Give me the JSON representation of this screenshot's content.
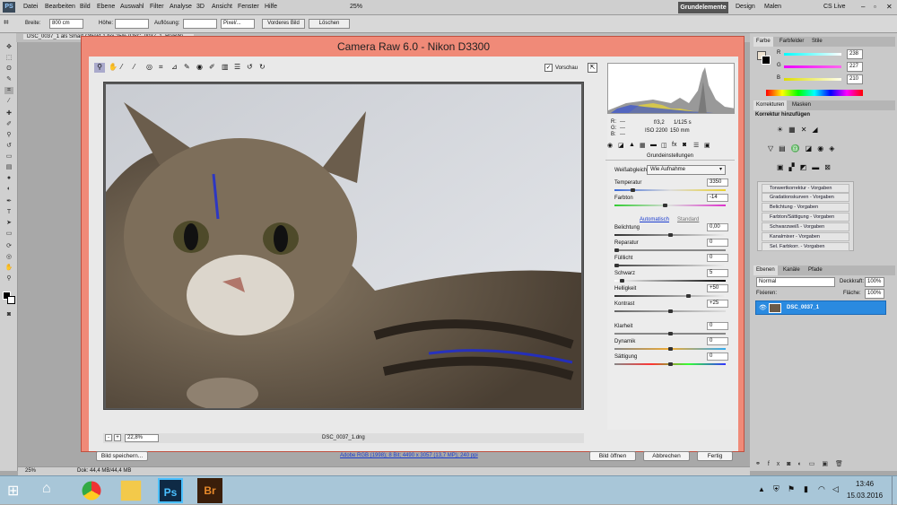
{
  "menubar": {
    "app_logo": "PS",
    "items": [
      "Datei",
      "Bearbeiten",
      "Bild",
      "Ebene",
      "Auswahl",
      "Filter",
      "Analyse",
      "3D",
      "Ansicht",
      "Fenster",
      "Hilfe"
    ],
    "zoom": "25%",
    "workspaces": {
      "active": "Grundelemente",
      "others": [
        "Design",
        "Malen"
      ]
    },
    "cs_live": "CS Live"
  },
  "optbar": {
    "width_label": "Breite:",
    "width_value": "800 cm",
    "height_label": "Höhe:",
    "height_value": "",
    "resolution_label": "Auflösung:",
    "resolution_value": "",
    "unit": "Pixel/...",
    "front_image_button": "Vorderes Bild",
    "clear_button": "Löschen"
  },
  "tab": {
    "title": "DSC_0037_1 als Smart-Objekt-1 bei 25% (DSC_0037_1, RGB/8)"
  },
  "status": {
    "zoom": "25%",
    "doc": "Dok: 44,4 MB/44,4 MB"
  },
  "dialog": {
    "title": "Camera Raw 6.0 - Nikon D3300",
    "preview_label": "Vorschau",
    "zoom_select": "22,8%",
    "filename": "DSC_0037_1.dng",
    "save_button": "Bild speichern...",
    "workflow_link": "Adobe RGB (1998); 8 Bit; 4490 x 3057 (13,7 MP); 240 ppi",
    "open_button": "Bild öffnen",
    "cancel_button": "Abbrechen",
    "done_button": "Fertig",
    "info": {
      "r": "R:",
      "g": "G:",
      "b": "B:",
      "rgb_value": "---",
      "aperture": "f/3,2",
      "shutter": "1/125 s",
      "iso": "ISO 2200",
      "focal": "150 mm"
    },
    "panel_title": "Grundeinstellungen",
    "wb_label": "Weißabgleich:",
    "wb_value": "Wie Aufnahme",
    "auto_link": "Automatisch",
    "default_link": "Standard",
    "sliders": [
      {
        "label": "Temperatur",
        "value": "3350",
        "pos": 0.15
      },
      {
        "label": "Farbton",
        "value": "-14",
        "pos": 0.45
      },
      {
        "label": "Belichtung",
        "value": "0,00",
        "pos": 0.5
      },
      {
        "label": "Reparatur",
        "value": "0",
        "pos": 0.0
      },
      {
        "label": "Fülllicht",
        "value": "0",
        "pos": 0.0
      },
      {
        "label": "Schwarz",
        "value": "5",
        "pos": 0.05
      },
      {
        "label": "Helligkeit",
        "value": "+50",
        "pos": 0.67
      },
      {
        "label": "Kontrast",
        "value": "+25",
        "pos": 0.5
      },
      {
        "label": "Klarheit",
        "value": "0",
        "pos": 0.5
      },
      {
        "label": "Dynamik",
        "value": "0",
        "pos": 0.5
      },
      {
        "label": "Sättigung",
        "value": "0",
        "pos": 0.5
      }
    ]
  },
  "right_panels": {
    "color_tabs": [
      "Farbe",
      "Farbfelder",
      "Stile"
    ],
    "r_value": "238",
    "g_value": "227",
    "b_value": "210",
    "r_label": "R",
    "g_label": "G",
    "b_label": "B",
    "adjust_tabs": [
      "Korrekturen",
      "Masken"
    ],
    "adjust_title": "Korrektur hinzufügen",
    "presets": [
      "Tonwertkorrektur - Vorgaben",
      "Gradationskurven - Vorgaben",
      "Belichtung - Vorgaben",
      "Farbton/Sättigung - Vorgaben",
      "Schwarzweiß - Vorgaben",
      "Kanalmixer - Vorgaben",
      "Sel. Farbkorr. - Vorgaben"
    ],
    "layer_tabs": [
      "Ebenen",
      "Kanäle",
      "Pfade"
    ],
    "blend_mode": "Normal",
    "opacity_label": "Deckkraft:",
    "opacity_value": "100%",
    "lock_label": "Fixieren:",
    "fill_label": "Fläche:",
    "fill_value": "100%",
    "layer_name": "DSC_0037_1"
  },
  "taskbar": {
    "time": "13:46",
    "date": "15.03.2016",
    "ps_label": "Ps",
    "br_label": "Br"
  }
}
